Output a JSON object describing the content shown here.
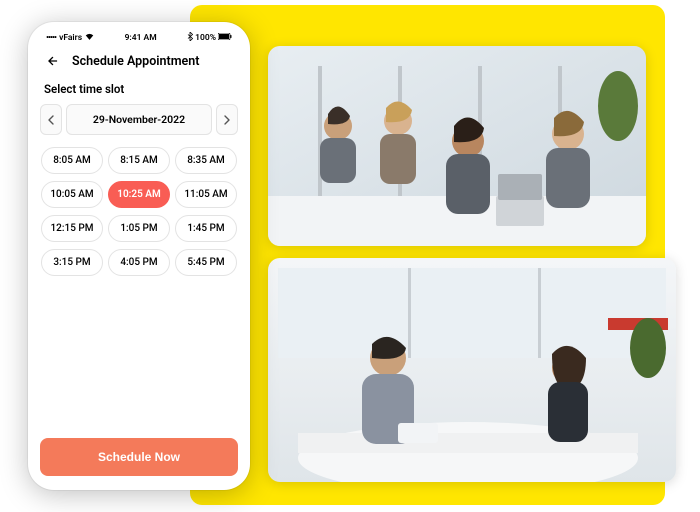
{
  "statusBar": {
    "carrier": "vFairs",
    "time": "9:41 AM",
    "battery": "100%"
  },
  "header": {
    "title": "Schedule Appointment"
  },
  "selectLabel": "Select time slot",
  "dateSelector": {
    "date": "29-November-2022"
  },
  "slots": [
    {
      "label": "8:05 AM",
      "selected": false
    },
    {
      "label": "8:15 AM",
      "selected": false
    },
    {
      "label": "8:35 AM",
      "selected": false
    },
    {
      "label": "10:05 AM",
      "selected": false
    },
    {
      "label": "10:25 AM",
      "selected": true
    },
    {
      "label": "11:05 AM",
      "selected": false
    },
    {
      "label": "12:15 PM",
      "selected": false
    },
    {
      "label": "1:05 PM",
      "selected": false
    },
    {
      "label": "1:45 PM",
      "selected": false
    },
    {
      "label": "3:15 PM",
      "selected": false
    },
    {
      "label": "4:05 PM",
      "selected": false
    },
    {
      "label": "5:45 PM",
      "selected": false
    }
  ],
  "cta": {
    "label": "Schedule Now"
  },
  "accentColor": "#f95d54",
  "ctaColor": "#f47a5a"
}
